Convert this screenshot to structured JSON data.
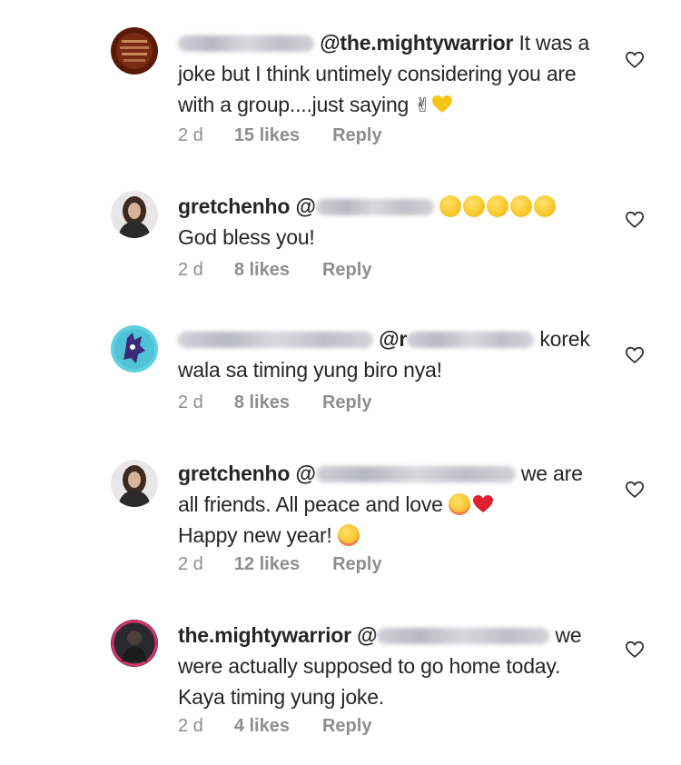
{
  "comments": [
    {
      "username": "ramcor0810",
      "mention": "@the.mightywarrior",
      "body": " It was a joke but I think untimely considering you are with a group....just saying ",
      "emojis": [
        "victory-hand",
        "yellow-heart"
      ],
      "time": "2 d",
      "likes": "15 likes",
      "reply": "Reply"
    },
    {
      "username": "gretchenho",
      "mention": "@ramcor0810",
      "body": "God bless you!",
      "emojis": [
        "laughing-face",
        "laughing-face",
        "laughing-face",
        "laughing-face",
        "laughing-face"
      ],
      "time": "2 d",
      "likes": "8 likes",
      "reply": "Reply"
    },
    {
      "username": "hailey_loves_anime",
      "mention": "@ramcor0810",
      "body": " korek wala sa timing yung biro nya!",
      "time": "2 d",
      "likes": "8 likes",
      "reply": "Reply"
    },
    {
      "username": "gretchenho",
      "mention": "@hailey_loves_anime",
      "body": " we are all friends. All peace and love ",
      "body2": "Happy new year! ",
      "emojis": [
        "hugging-face",
        "red-heart",
        "smiling-face"
      ],
      "time": "2 d",
      "likes": "12 likes",
      "reply": "Reply"
    },
    {
      "username": "the.mightywarrior",
      "mention": "@hailey_loves_anime",
      "body": " we were actually supposed to go home today. Kaya timing yung joke.",
      "time": "2 d",
      "likes": "4 likes",
      "reply": "Reply"
    }
  ],
  "icons": {
    "like": "heart-outline-icon"
  },
  "colors": {
    "text": "#262626",
    "meta": "#8e8e8e",
    "background": "#ffffff"
  }
}
